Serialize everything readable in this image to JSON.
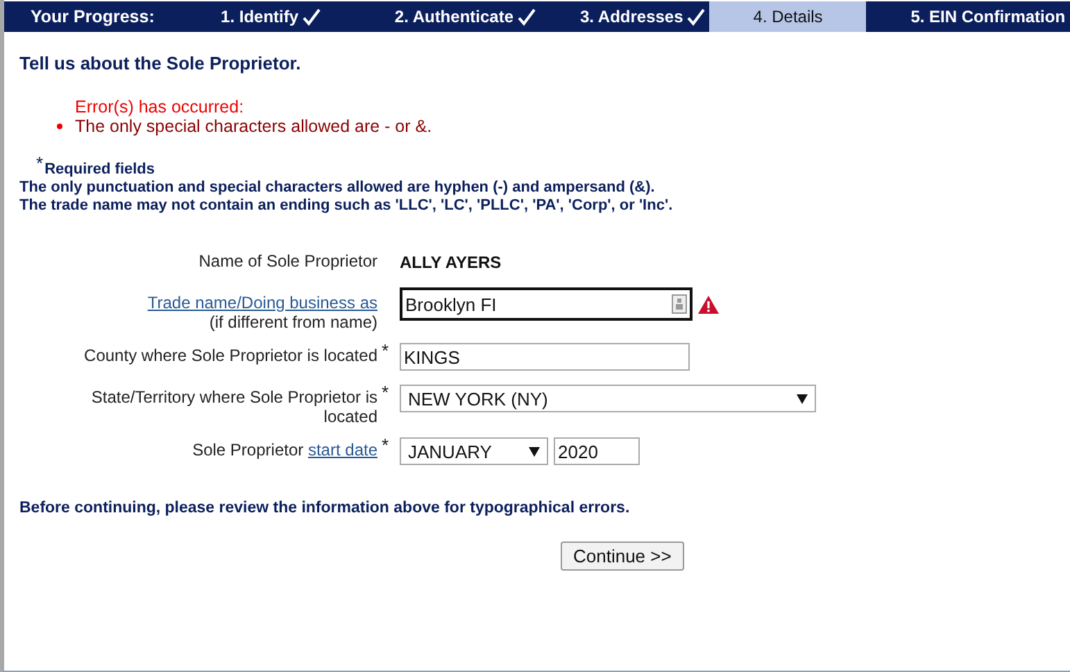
{
  "progress": {
    "label": "Your Progress:",
    "steps": [
      {
        "label": "1. Identify",
        "completed": true,
        "selected": false
      },
      {
        "label": "2. Authenticate",
        "completed": true,
        "selected": false
      },
      {
        "label": "3. Addresses",
        "completed": true,
        "selected": false
      },
      {
        "label": "4. Details",
        "completed": false,
        "selected": true
      },
      {
        "label": "5. EIN Confirmation",
        "completed": false,
        "selected": false
      }
    ]
  },
  "heading": "Tell us about the Sole Proprietor.",
  "errors": {
    "title": "Error(s) has occurred:",
    "items": [
      "The only special characters allowed are - or &."
    ]
  },
  "notes": {
    "required_mark": "*",
    "required_label": "Required fields",
    "lines": [
      "The only punctuation and special characters allowed are hyphen (-) and ampersand (&).",
      "The trade name may not contain an ending such as 'LLC', 'LC', 'PLLC', 'PA', 'Corp', or 'Inc'."
    ]
  },
  "fields": [
    {
      "kind": "static",
      "label": [
        {
          "text": "Name of Sole Proprietor",
          "link": false
        }
      ],
      "value": "ALLY AYERS"
    },
    {
      "kind": "text",
      "label": [
        {
          "text": "Trade name/Doing business as",
          "link": true
        },
        {
          "text": "(if different from name)",
          "link": false
        }
      ],
      "value": "Brooklyn FI",
      "error": true
    },
    {
      "kind": "text",
      "label": [
        {
          "text": "County where Sole Proprietor is located",
          "link": false
        }
      ],
      "required_mark": "*",
      "value": "KINGS",
      "error": false
    },
    {
      "kind": "select",
      "label": [
        {
          "text": "State/Territory where Sole Proprietor is located",
          "link": false
        }
      ],
      "required_mark": "*",
      "value": "NEW YORK (NY)"
    },
    {
      "kind": "date",
      "label": [
        {
          "text": "Sole Proprietor",
          "link": false
        },
        {
          "text": "start date",
          "link": true
        }
      ],
      "required_mark": "*",
      "month": "JANUARY",
      "year": "2020"
    }
  ],
  "review_note": "Before continuing, please review the information above for typographical errors.",
  "continue_button": "Continue >>"
}
